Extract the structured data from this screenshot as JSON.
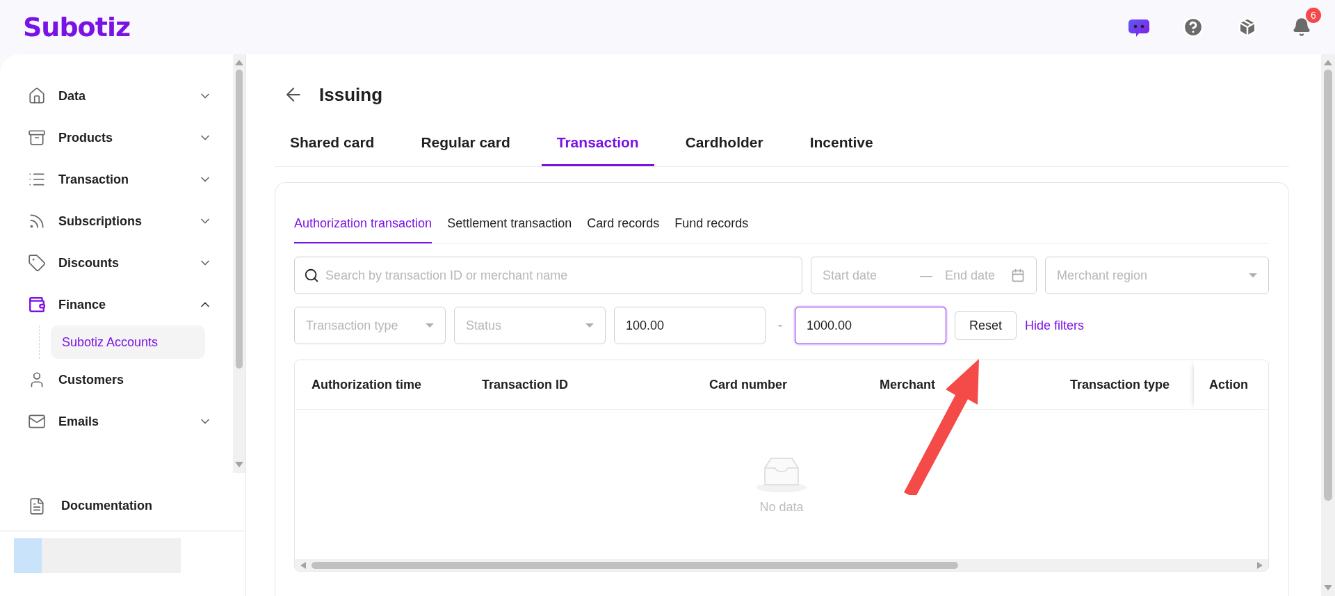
{
  "header": {
    "logo": "Subotiz",
    "notification_count": "6"
  },
  "sidebar": {
    "items": [
      {
        "label": "Data",
        "kind": "group",
        "expanded": false,
        "selected": false
      },
      {
        "label": "Products",
        "kind": "group",
        "expanded": false,
        "selected": false
      },
      {
        "label": "Transaction",
        "kind": "group",
        "expanded": false,
        "selected": false
      },
      {
        "label": "Subscriptions",
        "kind": "group",
        "expanded": false,
        "selected": false
      },
      {
        "label": "Discounts",
        "kind": "group",
        "expanded": false,
        "selected": false
      },
      {
        "label": "Finance",
        "kind": "group",
        "expanded": true,
        "selected": true,
        "children": [
          {
            "label": "Subotiz Accounts",
            "selected": true
          }
        ]
      },
      {
        "label": "Customers",
        "kind": "link",
        "selected": false
      },
      {
        "label": "Emails",
        "kind": "group",
        "expanded": false,
        "selected": false
      }
    ],
    "footer_item": {
      "label": "Documentation"
    }
  },
  "page": {
    "title": "Issuing",
    "tabs": [
      {
        "label": "Shared card",
        "selected": false
      },
      {
        "label": "Regular card",
        "selected": false
      },
      {
        "label": "Transaction",
        "selected": true
      },
      {
        "label": "Cardholder",
        "selected": false
      },
      {
        "label": "Incentive",
        "selected": false
      }
    ],
    "subtabs": [
      {
        "label": "Authorization transaction",
        "selected": true
      },
      {
        "label": "Settlement transaction",
        "selected": false
      },
      {
        "label": "Card records",
        "selected": false
      },
      {
        "label": "Fund records",
        "selected": false
      }
    ],
    "filters": {
      "search": {
        "placeholder": "Search by transaction ID or merchant name"
      },
      "date_range": {
        "start_placeholder": "Start date",
        "separator": "—",
        "end_placeholder": "End date"
      },
      "region": {
        "placeholder": "Merchant region"
      },
      "type": {
        "placeholder": "Transaction type"
      },
      "status": {
        "placeholder": "Status"
      },
      "amount_min": {
        "value": "100.00",
        "focused": false
      },
      "amount_separator": "-",
      "amount_max": {
        "value": "1000.00",
        "focused": true
      },
      "reset": "Reset",
      "toggle": "Hide filters"
    },
    "table": {
      "columns": [
        "Authorization time",
        "Transaction ID",
        "Card number",
        "Merchant",
        "Transaction type",
        "Action"
      ],
      "empty_text": "No data"
    }
  }
}
